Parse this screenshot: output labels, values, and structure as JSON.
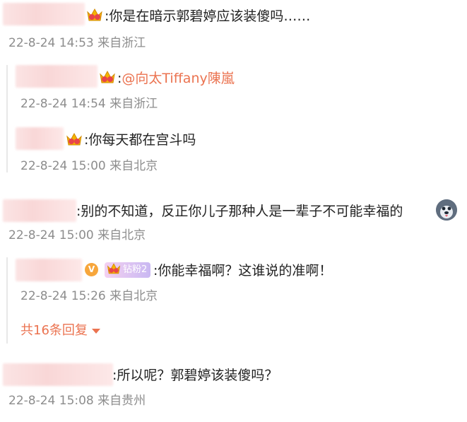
{
  "comments": [
    {
      "text": ":你是在暗示郭碧婷应该装傻吗……",
      "meta": "22-8-24 14:53 来自浙江",
      "replies": [
        {
          "text_prefix": ":",
          "mention": "@向太Tiffany陳嵐",
          "meta": "22-8-24 14:54 来自浙江"
        },
        {
          "text": ":你每天都在宫斗吗",
          "meta": "22-8-24 15:00 来自北京"
        }
      ]
    },
    {
      "text": ":别的不知道，反正你儿子那种人是一辈子不可能幸福的",
      "emoji": "husky-emoji",
      "meta": "22-8-24 15:00 来自北京",
      "replies": [
        {
          "badge_v": "V",
          "fan_badge": "钻粉2",
          "text": ":你能幸福啊？这谁说的准啊！",
          "meta": "22-8-24 15:26 来自北京"
        }
      ],
      "more_replies": "共16条回复"
    },
    {
      "text": ":所以呢？郭碧婷该装傻吗？",
      "meta": "22-8-24 15:08 来自贵州"
    }
  ],
  "colors": {
    "accent": "#eb7350",
    "meta": "#8d8d8d",
    "text": "#222222"
  }
}
